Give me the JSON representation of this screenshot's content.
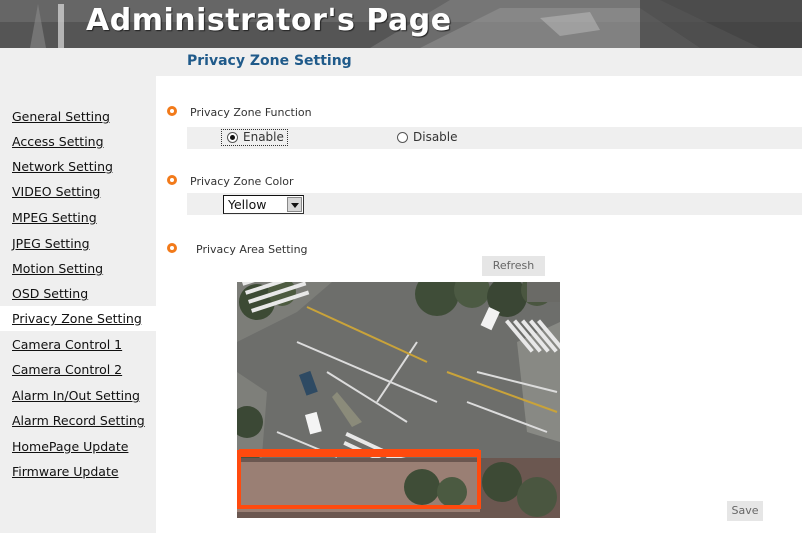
{
  "header": {
    "title": "Administrator's Page"
  },
  "sidebar": {
    "items": [
      {
        "label": "General Setting"
      },
      {
        "label": "Access Setting"
      },
      {
        "label": "Network Setting"
      },
      {
        "label": "VIDEO Setting"
      },
      {
        "label": "MPEG Setting"
      },
      {
        "label": "JPEG Setting"
      },
      {
        "label": "Motion Setting"
      },
      {
        "label": "OSD Setting"
      },
      {
        "label": "Privacy Zone Setting"
      },
      {
        "label": "Camera Control 1"
      },
      {
        "label": "Camera Control 2"
      },
      {
        "label": "Alarm In/Out Setting"
      },
      {
        "label": "Alarm Record Setting"
      },
      {
        "label": "HomePage Update"
      },
      {
        "label": "Firmware Update"
      }
    ],
    "active": "Privacy Zone Setting"
  },
  "main": {
    "section_title": "Privacy Zone Setting",
    "function": {
      "label": "Privacy Zone Function",
      "options": [
        {
          "label": "Enable",
          "checked": true
        },
        {
          "label": "Disable",
          "checked": false
        }
      ]
    },
    "color": {
      "label": "Privacy Zone Color",
      "selected": "Yellow"
    },
    "area": {
      "label": "Privacy Area Setting",
      "refresh_label": "Refresh"
    },
    "save_label": "Save"
  },
  "colors": {
    "accent_bullet": "#f27a1a",
    "section_title": "#1f5a8a",
    "privacy_box": "#ff4a0e"
  }
}
